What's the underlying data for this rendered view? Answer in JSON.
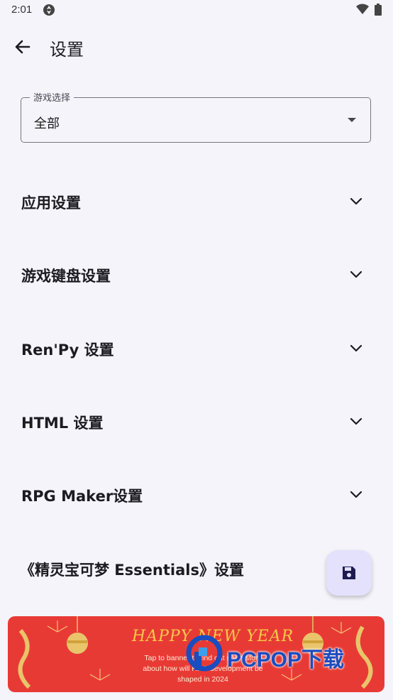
{
  "status_bar": {
    "time": "2:01"
  },
  "header": {
    "title": "设置"
  },
  "game_select": {
    "label": "游戏选择",
    "value": "全部"
  },
  "sections": [
    {
      "label": "应用设置"
    },
    {
      "label": "游戏键盘设置"
    },
    {
      "label": "Ren'Py 设置"
    },
    {
      "label": "HTML 设置"
    },
    {
      "label": "RPG Maker设置"
    },
    {
      "label": "《精灵宝可梦 Essentials》设置"
    }
  ],
  "fab": {
    "icon": "save-icon",
    "color": "#e3e1fb"
  },
  "banner": {
    "title": "HAPPY NEW YEAR",
    "subtitle_line1": "Tap to banner to find out short story",
    "subtitle_line2": "about how will RPG development be",
    "subtitle_line3": "shaped in 2024",
    "color": "#e83a35"
  },
  "watermark": {
    "text": "PCPOP下载"
  }
}
